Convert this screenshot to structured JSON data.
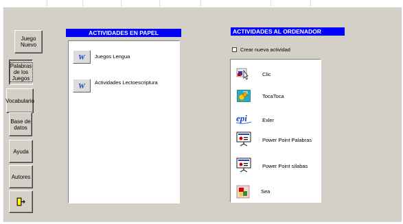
{
  "sidebar": {
    "buttons": [
      {
        "label": "Juego\nNuevo"
      },
      {
        "label": "Palabras\nde los\nJuegos"
      },
      {
        "label": "Vocabulario"
      },
      {
        "label": "Base de\ndatos"
      },
      {
        "label": "Ayuda"
      },
      {
        "label": "Autores"
      },
      {
        "icon": "exit-door-icon"
      }
    ]
  },
  "papel": {
    "title": "ACTIVIDADES EN PAPEL",
    "items": [
      {
        "label": "Juegos Lengua",
        "icon": "word-document-icon"
      },
      {
        "label": "Actividades Lectoescriptura",
        "icon": "word-document-icon"
      }
    ]
  },
  "ordenador": {
    "title": "ACTIVIDADES AL ORDENADOR",
    "checkbox_label": "Crear nueva actividad",
    "checkbox_checked": false,
    "items": [
      {
        "label": "Clic",
        "icon": "clic-app-icon"
      },
      {
        "label": "TocaToca",
        "icon": "tocatoca-app-icon"
      },
      {
        "label": "Exler",
        "icon": "epi-exler-icon"
      },
      {
        "label": "Power Point Palabras",
        "icon": "powerpoint-presentation-icon"
      },
      {
        "label": "Power Point sílabas",
        "icon": "powerpoint-presentation-icon"
      },
      {
        "label": "Sea",
        "icon": "sea-app-icon"
      }
    ]
  },
  "colors": {
    "header_bg": "#0000ff",
    "window_bg": "#d4d0c8",
    "panel_bg": "#ffffff"
  }
}
